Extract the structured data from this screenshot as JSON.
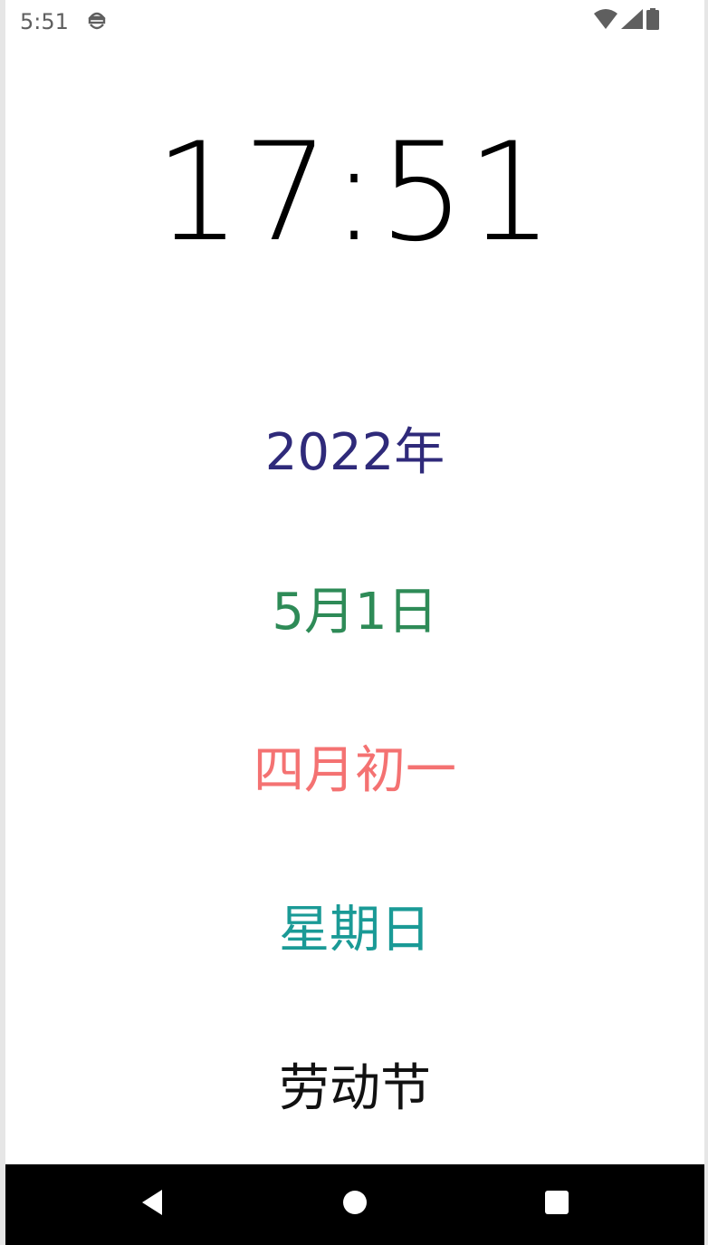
{
  "status_bar": {
    "time": "5:51",
    "notification_icon": "android-debug-icon",
    "wifi_icon": "wifi-icon",
    "signal_icon": "cell-signal-icon",
    "battery_icon": "battery-icon"
  },
  "clock": {
    "time": "17:51"
  },
  "calendar": {
    "year": "2022年",
    "year_color": "#2f2a7a",
    "date": "5月1日",
    "date_color": "#2e8b57",
    "lunar": "四月初一",
    "lunar_color": "#f47272",
    "weekday": "星期日",
    "weekday_color": "#1a9a96",
    "holiday": "劳动节",
    "holiday_color": "#111111"
  },
  "nav_bar": {
    "back_icon": "back-triangle-icon",
    "home_icon": "home-circle-icon",
    "recents_icon": "recents-square-icon"
  }
}
